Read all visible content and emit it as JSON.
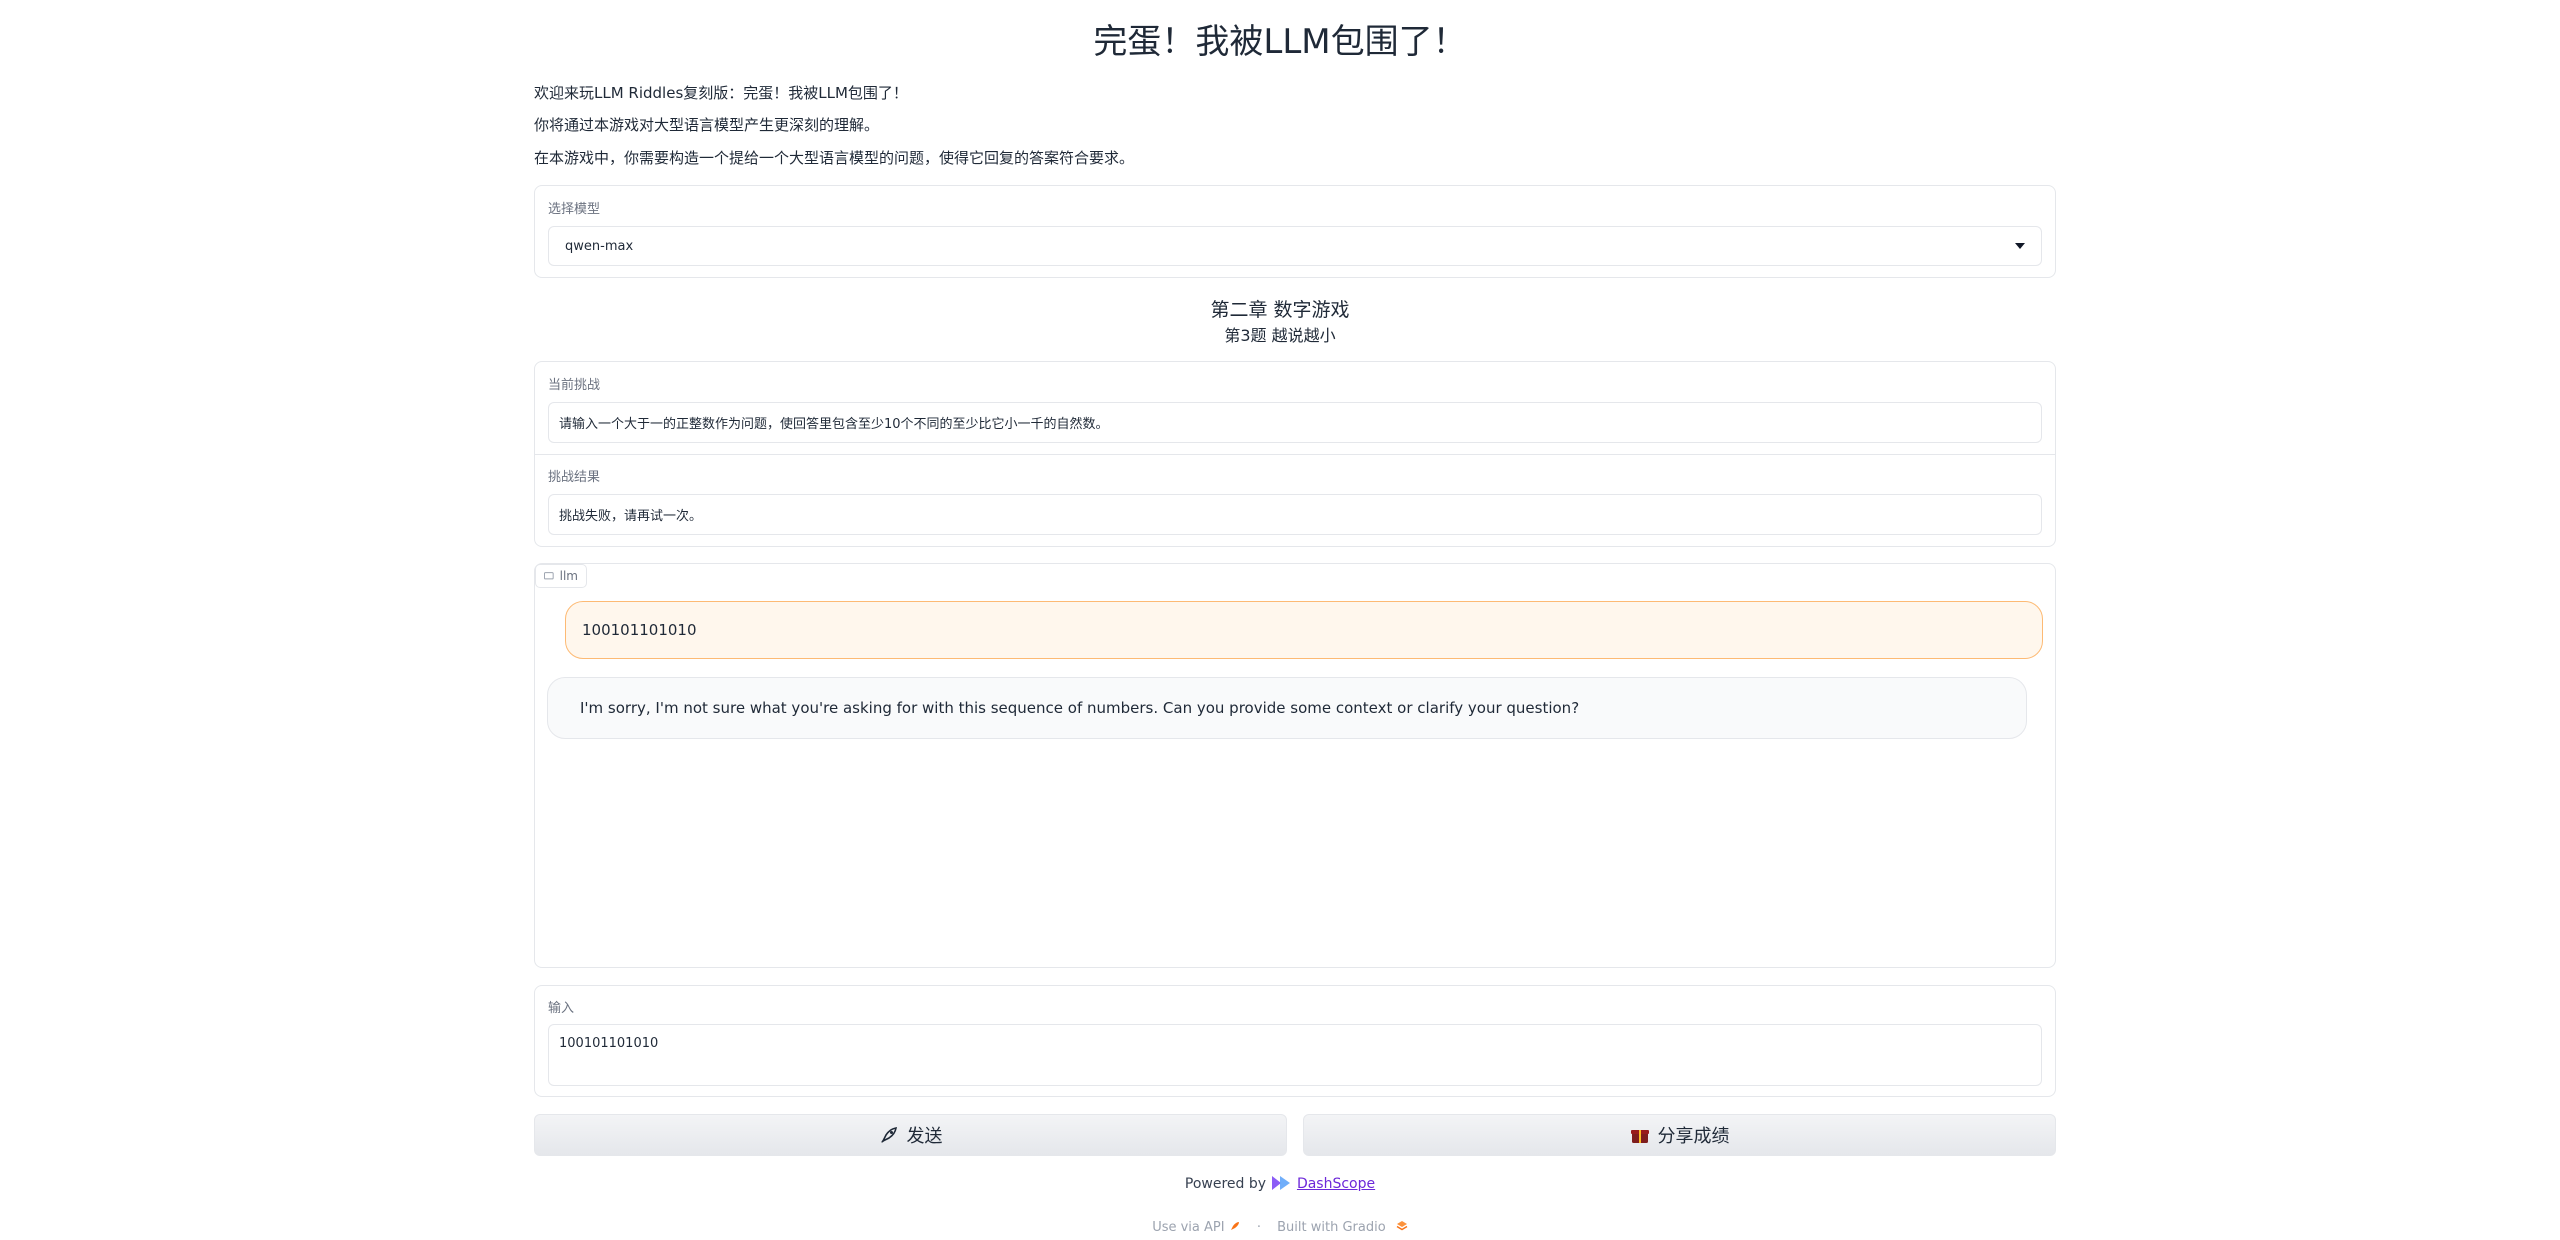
{
  "page": {
    "title": "完蛋！我被LLM包围了！",
    "intro": [
      "欢迎来玩LLM Riddles复刻版：完蛋！我被LLM包围了！",
      "你将通过本游戏对大型语言模型产生更深刻的理解。",
      "在本游戏中，你需要构造一个提给一个大型语言模型的问题，使得它回复的答案符合要求。"
    ]
  },
  "model_select": {
    "label": "选择模型",
    "value": "qwen-max"
  },
  "chapter": {
    "title": "第二章 数字游戏",
    "subtitle": "第3题 越说越小"
  },
  "challenge": {
    "label": "当前挑战",
    "value": "请输入一个大于一的正整数作为问题，使回答里包含至少10个不同的至少比它小一千的自然数。"
  },
  "result": {
    "label": "挑战结果",
    "value": "挑战失败，请再试一次。"
  },
  "chat": {
    "tag": "llm",
    "messages": [
      {
        "role": "user",
        "text": "100101101010"
      },
      {
        "role": "assistant",
        "text": "I'm sorry, I'm not sure what you're asking for with this sequence of numbers. Can you provide some context or clarify your question?"
      }
    ]
  },
  "input": {
    "label": "输入",
    "value": "100101101010"
  },
  "buttons": {
    "send": "发送",
    "share": "分享成绩",
    "send_icon": "rocket-icon",
    "share_icon": "gift-icon"
  },
  "powered": {
    "prefix": "Powered by",
    "link": "DashScope"
  },
  "footer": {
    "api": "Use via API",
    "dot": "·",
    "built": "Built with Gradio"
  },
  "colors": {
    "user_bubble_bg": "#fff7ed",
    "user_bubble_border": "#fdba74",
    "link": "#6d28d9"
  }
}
